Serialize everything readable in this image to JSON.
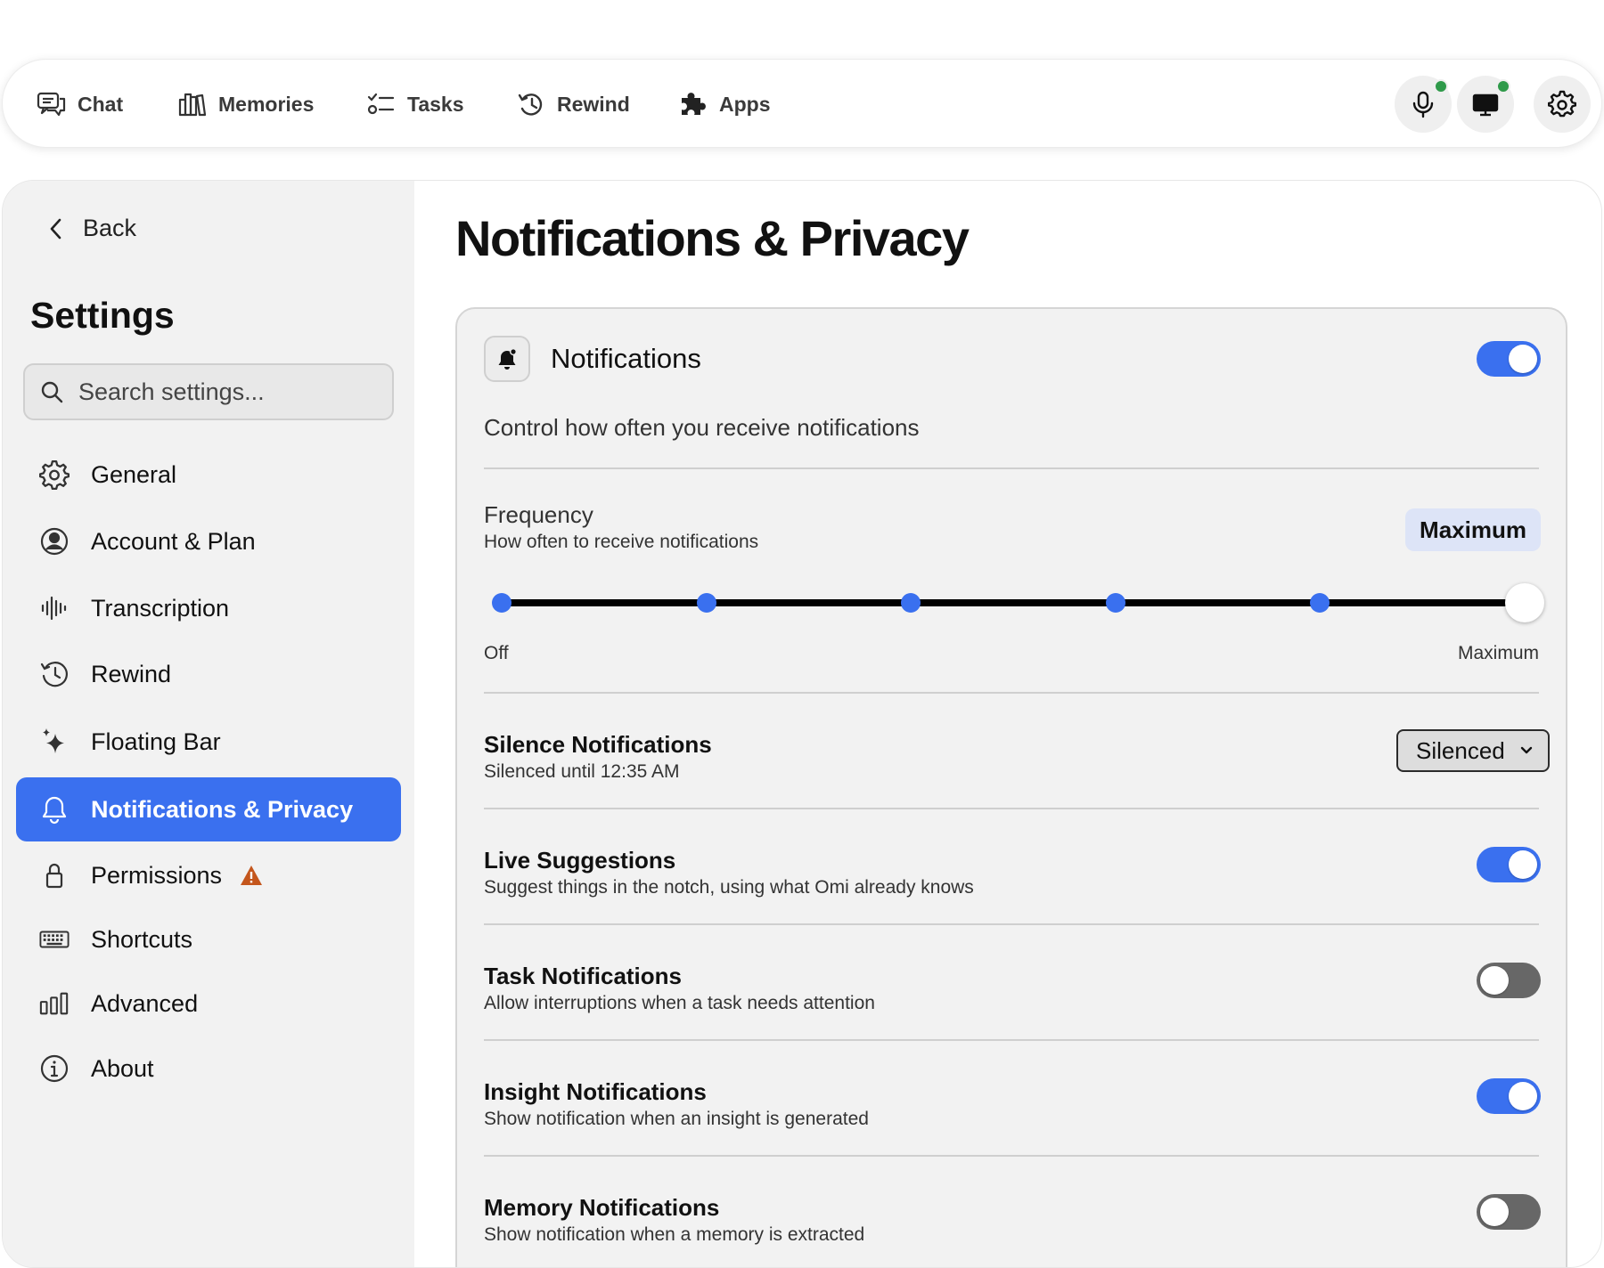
{
  "topnav": {
    "items": [
      {
        "label": "Chat",
        "icon": "chat-icon"
      },
      {
        "label": "Memories",
        "icon": "memories-icon"
      },
      {
        "label": "Tasks",
        "icon": "tasks-icon"
      },
      {
        "label": "Rewind",
        "icon": "rewind-icon"
      },
      {
        "label": "Apps",
        "icon": "puzzle-icon"
      }
    ],
    "buttons": [
      "microphone-icon",
      "screen-icon",
      "gear-icon"
    ],
    "live_indicator_color": "#2f9a4a"
  },
  "sidebar": {
    "back_label": "Back",
    "title": "Settings",
    "search_placeholder": "Search settings...",
    "items": [
      {
        "label": "General",
        "icon": "gear-icon"
      },
      {
        "label": "Account & Plan",
        "icon": "account-icon"
      },
      {
        "label": "Transcription",
        "icon": "waveform-icon"
      },
      {
        "label": "Rewind",
        "icon": "rewind-icon"
      },
      {
        "label": "Floating Bar",
        "icon": "sparkle-icon"
      },
      {
        "label": "Notifications & Privacy",
        "icon": "bell-icon",
        "active": true
      },
      {
        "label": "Permissions",
        "icon": "lock-icon",
        "warning": true
      },
      {
        "label": "Shortcuts",
        "icon": "keyboard-icon"
      },
      {
        "label": "Advanced",
        "icon": "chart-bars-icon"
      },
      {
        "label": "About",
        "icon": "info-icon"
      }
    ]
  },
  "content": {
    "title": "Notifications & Privacy",
    "card": {
      "title": "Notifications",
      "enabled": true,
      "description": "Control how often you receive notifications",
      "frequency": {
        "label": "Frequency",
        "sub": "How often to receive notifications",
        "value_label": "Maximum",
        "level": 5,
        "max_level": 5,
        "min_label": "Off",
        "max_label": "Maximum"
      },
      "silence": {
        "title": "Silence Notifications",
        "sub": "Silenced until 12:35 AM",
        "selected": "Silenced"
      },
      "rows": [
        {
          "title": "Live Suggestions",
          "sub": "Suggest things in the notch, using what Omi already knows",
          "on": true
        },
        {
          "title": "Task Notifications",
          "sub": "Allow interruptions when a task needs attention",
          "on": false
        },
        {
          "title": "Insight Notifications",
          "sub": "Show notification when an insight is generated",
          "on": true
        },
        {
          "title": "Memory Notifications",
          "sub": "Show notification when a memory is extracted",
          "on": false
        }
      ]
    }
  },
  "colors": {
    "accent": "#3a70ef",
    "toggle_off": "#676767",
    "warning": "#c4561c",
    "badge_bg": "#dde4f7"
  }
}
